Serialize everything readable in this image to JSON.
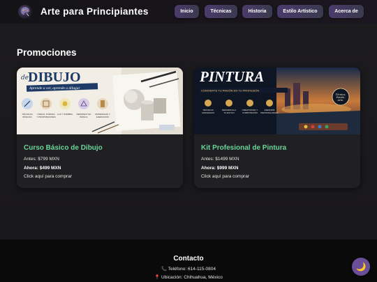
{
  "header": {
    "site_title": "Arte para Principiantes",
    "logo_icon": "palette-logo-icon",
    "nav": [
      {
        "label": "Inicio"
      },
      {
        "label": "Técnicas"
      },
      {
        "label": "Historia"
      },
      {
        "label": "Estilo Artístico"
      },
      {
        "label": "Acerca de"
      }
    ]
  },
  "section": {
    "title": "Promociones"
  },
  "products": [
    {
      "image_icon": "drawing-course-banner",
      "banner_title": "de DIBUJO",
      "banner_subtitle": "Aprende a ver, aprende a dibujar",
      "banner_topics": [
        "TÉCNICAS BÁSICAS",
        "LÍNEAS, FORMAS Y PROPORCIONES",
        "LUZ Y SOMBRA",
        "PERSPECTIVA BÁSICA",
        "MATERIALES Y EJERCICIOS PRÁCTICOS"
      ],
      "name": "Curso Básico de Dibujo",
      "before": "Antes: $799 MXN",
      "now": "Ahora: $499 MXN",
      "cta": "Click aquí para comprar"
    },
    {
      "image_icon": "painting-kit-banner",
      "banner_title": "PINTURA",
      "banner_subtitle": "CONVIERTE TU PASIÓN EN TU PROFESIÓN",
      "banner_topics": [
        "TÉCNICAS AVANZADAS",
        "DESARROLLA TU ESTILO",
        "CREATIVIDAD Y COMPOSICIÓN",
        "ASESORÍA PERSONALIZADA"
      ],
      "banner_badge": "Técnica, Pasión, Arte.",
      "name": "Kit Profesional de Pintura",
      "before": "Antes: $1499 MXN",
      "now": "Ahora: $999 MXN",
      "cta": "Click aquí para comprar"
    }
  ],
  "footer": {
    "title": "Contacto",
    "phone": "📞 Teléfono: 614-115-0804",
    "location": "📍 Ubicación: Chihuahua, México"
  },
  "theme_toggle": {
    "icon": "moon-icon",
    "glyph": "🌙"
  }
}
